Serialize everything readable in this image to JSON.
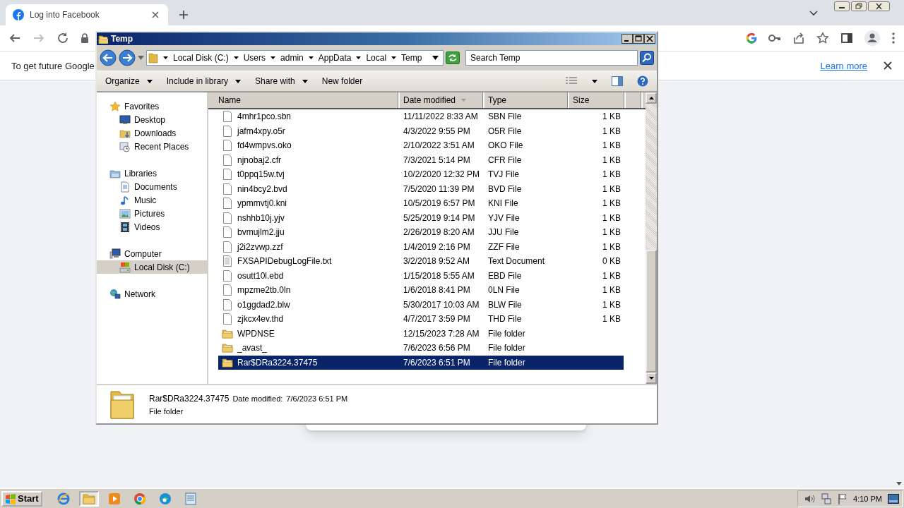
{
  "browser": {
    "tabs": [
      {
        "title": "Log into Facebook",
        "selected": true
      }
    ],
    "infobar": {
      "message": "To get future Google",
      "link": "Learn more"
    }
  },
  "explorer": {
    "title": "Temp",
    "breadcrumb": [
      "Local Disk (C:)",
      "Users",
      "admin",
      "AppData",
      "Local",
      "Temp"
    ],
    "search": {
      "placeholder": "Search Temp"
    },
    "commands": [
      {
        "label": "Organize",
        "menu": true
      },
      {
        "label": "Include in library",
        "menu": true
      },
      {
        "label": "Share with",
        "menu": true
      },
      {
        "label": "New folder",
        "menu": false
      }
    ],
    "nav": [
      {
        "label": "Favorites",
        "kind": "star",
        "selected": false,
        "children": [
          {
            "label": "Desktop",
            "kind": "desktop",
            "selected": false
          },
          {
            "label": "Downloads",
            "kind": "downloads",
            "selected": false
          },
          {
            "label": "Recent Places",
            "kind": "recent",
            "selected": false
          }
        ]
      },
      {
        "label": "Libraries",
        "kind": "libraries",
        "selected": false,
        "children": [
          {
            "label": "Documents",
            "kind": "documents",
            "selected": false
          },
          {
            "label": "Music",
            "kind": "music",
            "selected": false
          },
          {
            "label": "Pictures",
            "kind": "pictures",
            "selected": false
          },
          {
            "label": "Videos",
            "kind": "videos",
            "selected": false
          }
        ]
      },
      {
        "label": "Computer",
        "kind": "computer",
        "selected": false,
        "children": [
          {
            "label": "Local Disk (C:)",
            "kind": "disk",
            "selected": true
          }
        ]
      },
      {
        "label": "Network",
        "kind": "network",
        "selected": false
      }
    ],
    "columns": [
      {
        "label": "Name",
        "sorted": false
      },
      {
        "label": "Date modified",
        "sorted": true
      },
      {
        "label": "Type",
        "sorted": false
      },
      {
        "label": "Size",
        "sorted": false
      }
    ],
    "rows": [
      {
        "name": "4mhr1pco.sbn",
        "date": "11/11/2022 8:33 AM",
        "type": "SBN File",
        "size": "1 KB",
        "kind": "file",
        "selected": false
      },
      {
        "name": "jafm4xpy.o5r",
        "date": "4/3/2022 9:55 PM",
        "type": "O5R File",
        "size": "1 KB",
        "kind": "file",
        "selected": false
      },
      {
        "name": "fd4wmpvs.oko",
        "date": "2/10/2022 3:51 AM",
        "type": "OKO File",
        "size": "1 KB",
        "kind": "file",
        "selected": false
      },
      {
        "name": "njnobaj2.cfr",
        "date": "7/3/2021 5:14 PM",
        "type": "CFR File",
        "size": "1 KB",
        "kind": "file",
        "selected": false
      },
      {
        "name": "t0ppq15w.tvj",
        "date": "10/2/2020 12:32 PM",
        "type": "TVJ File",
        "size": "1 KB",
        "kind": "file",
        "selected": false
      },
      {
        "name": "nin4bcy2.bvd",
        "date": "7/5/2020 11:39 PM",
        "type": "BVD File",
        "size": "1 KB",
        "kind": "file",
        "selected": false
      },
      {
        "name": "ypmmvtj0.kni",
        "date": "10/5/2019 6:57 PM",
        "type": "KNI File",
        "size": "1 KB",
        "kind": "file",
        "selected": false
      },
      {
        "name": "nshhb10j.yjv",
        "date": "5/25/2019 9:14 PM",
        "type": "YJV File",
        "size": "1 KB",
        "kind": "file",
        "selected": false
      },
      {
        "name": "bvmujlm2.jju",
        "date": "2/26/2019 8:20 AM",
        "type": "JJU File",
        "size": "1 KB",
        "kind": "file",
        "selected": false
      },
      {
        "name": "j2i2zvwp.zzf",
        "date": "1/4/2019 2:16 PM",
        "type": "ZZF File",
        "size": "1 KB",
        "kind": "file",
        "selected": false
      },
      {
        "name": "FXSAPIDebugLogFile.txt",
        "date": "3/2/2018 9:52 AM",
        "type": "Text Document",
        "size": "0 KB",
        "kind": "text",
        "selected": false
      },
      {
        "name": "osutt10l.ebd",
        "date": "1/15/2018 5:55 AM",
        "type": "EBD File",
        "size": "1 KB",
        "kind": "file",
        "selected": false
      },
      {
        "name": "mpzme2tb.0ln",
        "date": "1/6/2018 8:41 PM",
        "type": "0LN File",
        "size": "1 KB",
        "kind": "file",
        "selected": false
      },
      {
        "name": "o1ggdad2.blw",
        "date": "5/30/2017 10:03 AM",
        "type": "BLW File",
        "size": "1 KB",
        "kind": "file",
        "selected": false
      },
      {
        "name": "zjkcx4ev.thd",
        "date": "4/7/2017 3:59 PM",
        "type": "THD File",
        "size": "1 KB",
        "kind": "file",
        "selected": false
      },
      {
        "name": "WPDNSE",
        "date": "12/15/2023 7:28 AM",
        "type": "File folder",
        "kind": "folder",
        "selected": false
      },
      {
        "name": "_avast_",
        "date": "7/6/2023 6:56 PM",
        "type": "File folder",
        "kind": "folder",
        "selected": false
      },
      {
        "name": "Rar$DRa3224.37475",
        "date": "7/6/2023 6:51 PM",
        "type": "File folder",
        "kind": "folder",
        "selected": true
      }
    ],
    "details": {
      "name": "Rar$DRa3224.37475",
      "date_label": "Date modified:",
      "date": "7/6/2023 6:51 PM",
      "type": "File folder"
    }
  },
  "taskbar": {
    "start": "Start",
    "apps": [
      {
        "kind": "ie",
        "pressed": false
      },
      {
        "kind": "explorer",
        "pressed": true
      },
      {
        "kind": "media",
        "pressed": false
      },
      {
        "kind": "chrome",
        "pressed": false
      },
      {
        "kind": "edge",
        "pressed": false
      },
      {
        "kind": "notepad",
        "pressed": false
      }
    ],
    "clock": "4:10 PM"
  }
}
